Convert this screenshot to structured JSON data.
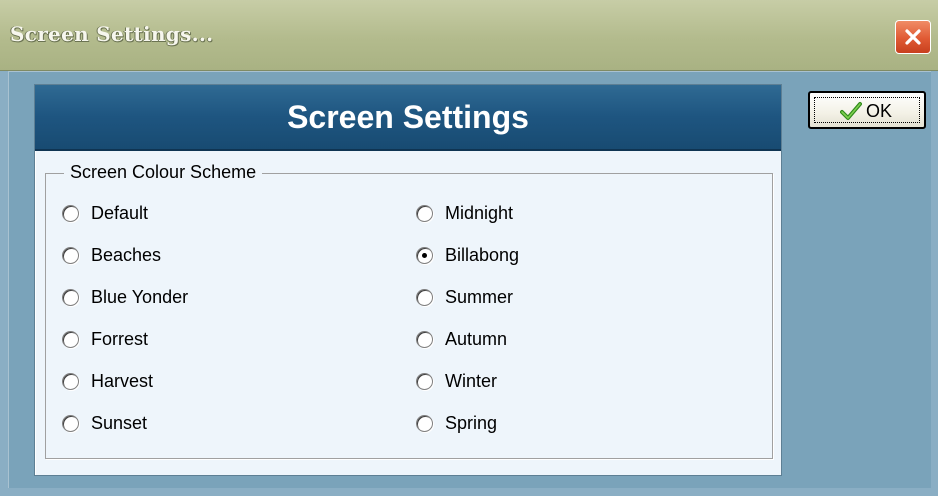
{
  "window": {
    "title": "Screen Settings...",
    "close_icon": "close-icon"
  },
  "panel": {
    "heading": "Screen Settings"
  },
  "group": {
    "label": "Screen Colour Scheme",
    "options": [
      {
        "label": "Default",
        "checked": false
      },
      {
        "label": "Beaches",
        "checked": false
      },
      {
        "label": "Blue Yonder",
        "checked": false
      },
      {
        "label": "Forrest",
        "checked": false
      },
      {
        "label": "Harvest",
        "checked": false
      },
      {
        "label": "Sunset",
        "checked": false
      },
      {
        "label": "Midnight",
        "checked": false
      },
      {
        "label": "Billabong",
        "checked": true
      },
      {
        "label": "Summer",
        "checked": false
      },
      {
        "label": "Autumn",
        "checked": false
      },
      {
        "label": "Winter",
        "checked": false
      },
      {
        "label": "Spring",
        "checked": false
      }
    ],
    "selected": "Billabong"
  },
  "ok_button": {
    "label": "OK",
    "icon": "checkmark-icon"
  },
  "colors": {
    "titlebar": "#b3bb8d",
    "background": "#7aa3ba",
    "panel_header": "#1e5580",
    "close_button": "#e05a34"
  }
}
